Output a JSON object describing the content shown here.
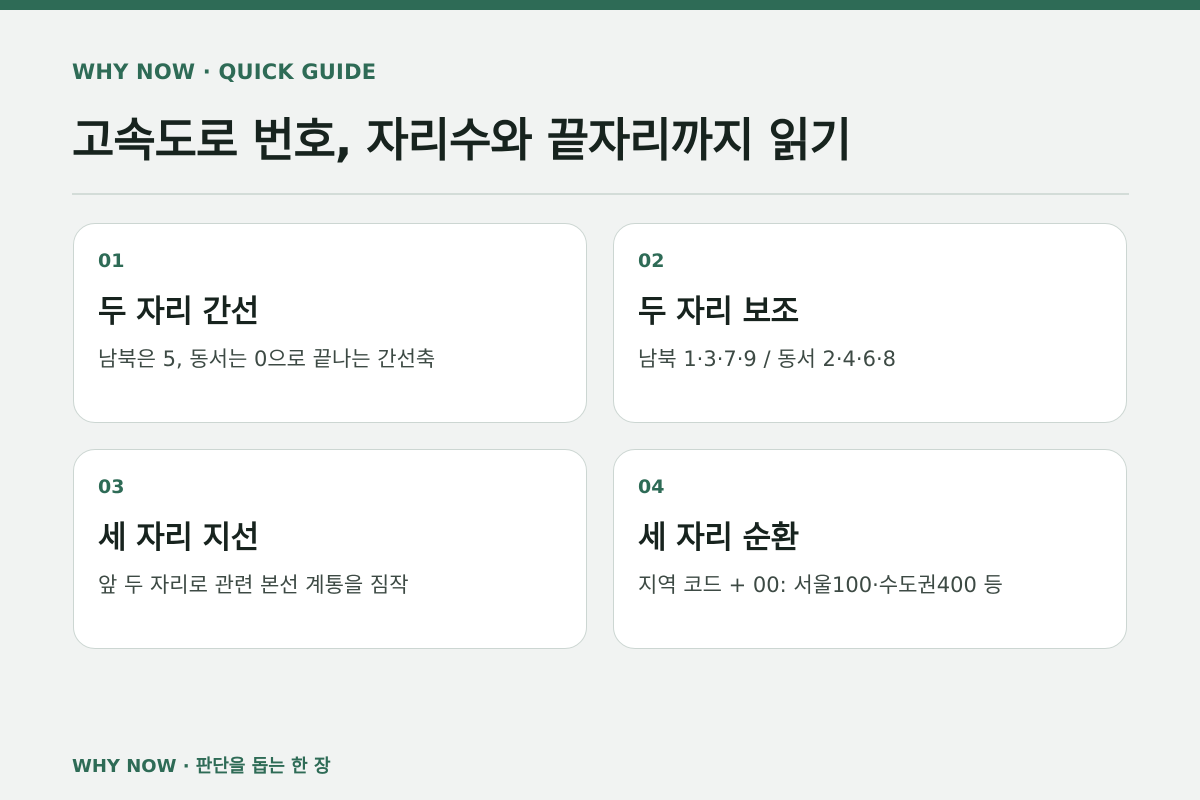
{
  "header": {
    "eyebrow": "WHY NOW · QUICK GUIDE",
    "title": "고속도로 번호, 자리수와 끝자리까지 읽기"
  },
  "cards": [
    {
      "number": "01",
      "title": "두 자리 간선",
      "description": "남북은 5, 동서는 0으로 끝나는 간선축"
    },
    {
      "number": "02",
      "title": "두 자리 보조",
      "description": "남북 1·3·7·9 / 동서 2·4·6·8"
    },
    {
      "number": "03",
      "title": "세 자리 지선",
      "description": "앞 두 자리로 관련 본선 계통을 짐작"
    },
    {
      "number": "04",
      "title": "세 자리 순환",
      "description": "지역 코드 + 00: 서울100·수도권400 등"
    }
  ],
  "footer": {
    "text": "WHY NOW · 판단을 돕는 한 장"
  },
  "colors": {
    "accent": "#2e6b56",
    "background": "#f1f3f2",
    "card": "#ffffff",
    "title_text": "#17231e"
  }
}
